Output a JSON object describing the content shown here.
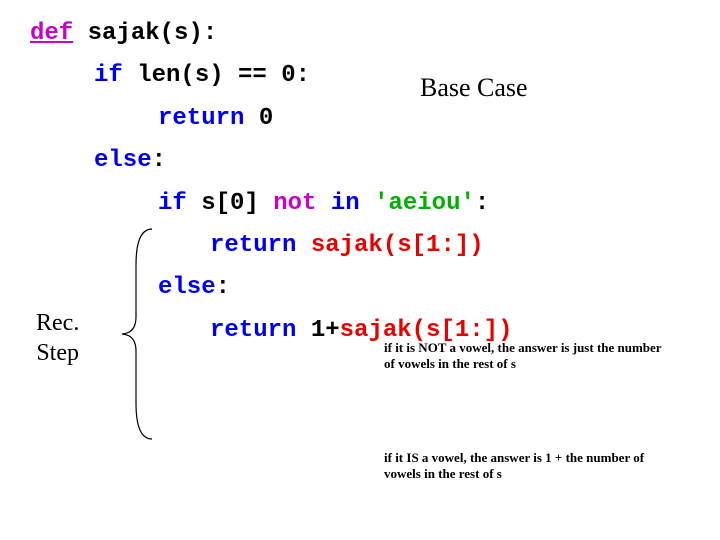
{
  "code": {
    "def": "def",
    "fn": " sajak(s):",
    "if1_kw": "if",
    "if1_rest": " len(s) == 0:",
    "ret0_kw": "return",
    "ret0_val": " 0",
    "else1": "else",
    "colon": ":",
    "if2_kw": "if",
    "if2_a": " s[0] ",
    "not": "not",
    "in": " in",
    "str": " 'aeiou'",
    "retA_kw": "return",
    "retA_val": " sajak(s[1:])",
    "else2": "else",
    "retB_kw": "return",
    "retB_1": " 1",
    "retB_plus": "+",
    "retB_call": "sajak(s[1:])"
  },
  "anno": {
    "base": "Base Case",
    "rec1": "Rec.",
    "rec2": "Step",
    "not_vowel": "if it is NOT a vowel, the answer is just the number of vowels in the rest of s",
    "is_vowel": "if it IS a vowel, the answer is 1 + the number of vowels in the rest of s"
  }
}
